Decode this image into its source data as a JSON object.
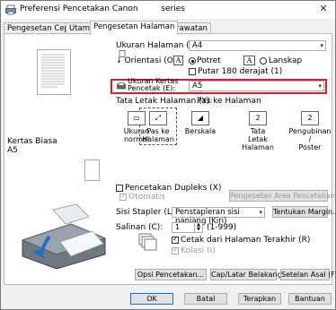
{
  "window": {
    "title": "Preferensi Pencetakan Canon",
    "title_suffix": "series",
    "close_label": "✕"
  },
  "tabs": [
    {
      "label": "Pengesetan Cepat"
    },
    {
      "label": "Utama"
    },
    {
      "label": "Pengesetan Halaman"
    },
    {
      "label": "Perawatan"
    }
  ],
  "left": {
    "paper_type": "Kertas Biasa",
    "paper_size": "A5"
  },
  "page_settings": {
    "page_size_label": "Ukuran Halaman (Z):",
    "page_size_value": "A4",
    "orientation_label": "Orientasi (O):",
    "portrait_label": "Potret",
    "landscape_label": "Lanskap",
    "rotate_label": "Putar 180 derajat (1)",
    "printer_paper_label_1": "Ukuran Kertas",
    "printer_paper_label_2": "Pencetak (E):",
    "printer_paper_value": "A5",
    "layout_label": "Tata Letak Halaman (Y):",
    "layout_value": "Pas ke Halaman",
    "layouts": [
      {
        "line1": "Ukuran normal",
        "line2": ""
      },
      {
        "line1": "Pas ke",
        "line2": "Halaman"
      },
      {
        "line1": "Berskala",
        "line2": ""
      },
      {
        "line1": "Tata Letak",
        "line2": "Halaman"
      },
      {
        "line1": "Pengubinan /",
        "line2": "Poster"
      }
    ],
    "duplex_label": "Pencetakan Dupleks (X)",
    "auto_label": "Otomatis",
    "duplex_area_button": "Pengesetan Area Pencetakan...",
    "stapler_label": "Sisi Stapler (L):",
    "stapler_value": "Penstapleran sisi panjang (Kiri)",
    "margin_button": "Tentukan Margin...",
    "copies_label": "Salinan (C):",
    "copies_value": "1",
    "copies_range": "(1-999)",
    "reverse_label": "Cetak dari Halaman Terakhir (R)",
    "collate_label": "Kolasi (I)",
    "options_button": "Opsi Pencetakan...",
    "stamp_button": "Cap/Latar Belakang...",
    "defaults_button": "Setelan Asal (F)"
  },
  "footer": {
    "ok": "OK",
    "cancel": "Batal",
    "apply": "Terapkan",
    "help": "Bantuan"
  }
}
